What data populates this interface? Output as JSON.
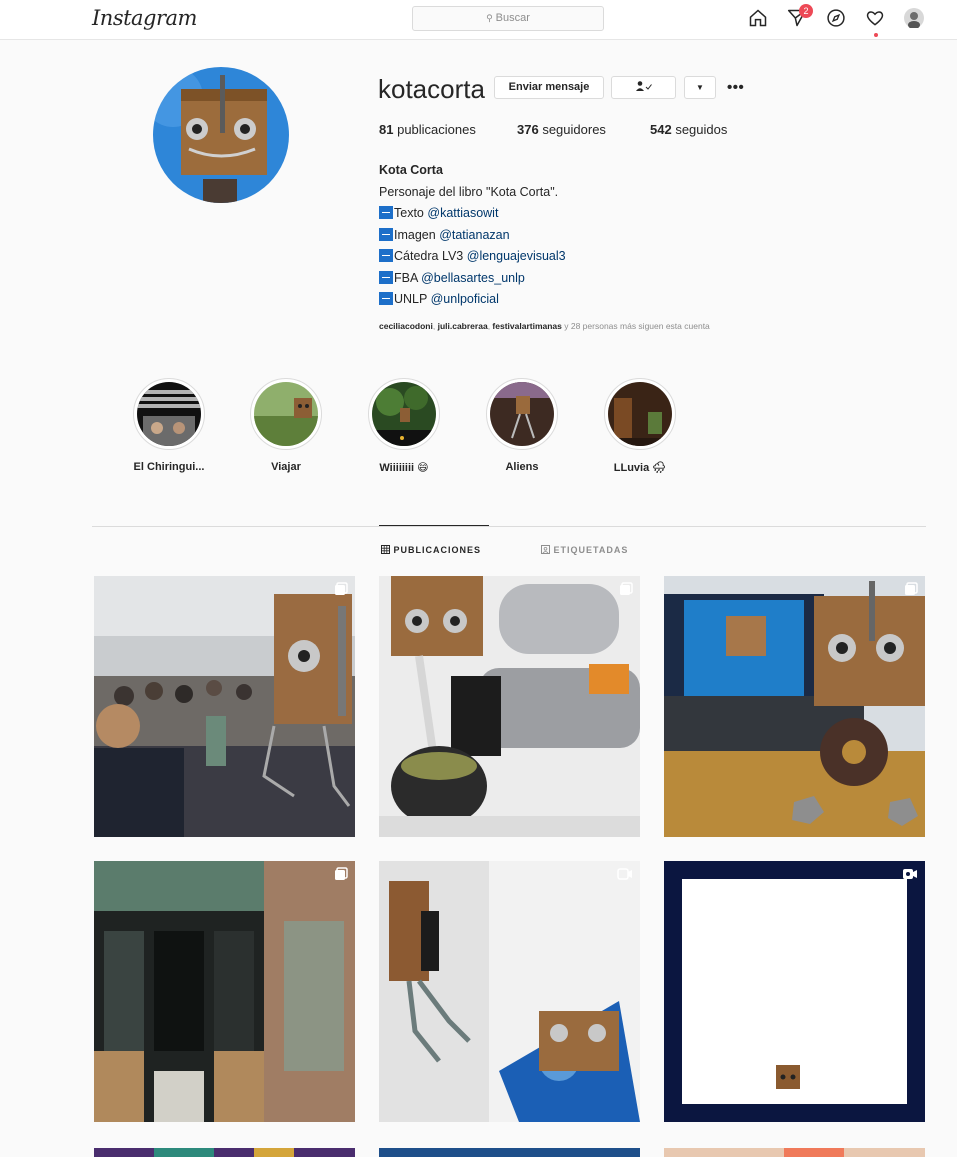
{
  "nav": {
    "logo": "Instagram",
    "search_placeholder": "Buscar",
    "notification_count": "2"
  },
  "profile": {
    "username": "kotacorta",
    "message_button": "Enviar mensaje",
    "follow_state_icon": "person-check-icon",
    "dropdown_icon": "caret-down-icon",
    "more_icon": "•••",
    "stats": {
      "posts": "81",
      "posts_label": "publicaciones",
      "followers": "376",
      "followers_label": "seguidores",
      "following": "542",
      "following_label": "seguidos"
    },
    "bio": {
      "name": "Kota Corta",
      "description": "Personaje del libro \"Kota Corta\".",
      "links": [
        {
          "prefix": "Texto",
          "handle": "@kattiasowit"
        },
        {
          "prefix": "Imagen",
          "handle": "@tatianazan"
        },
        {
          "prefix": "Cátedra LV3",
          "handle": "@lenguajevisual3"
        },
        {
          "prefix": "FBA",
          "handle": "@bellasartes_unlp"
        },
        {
          "prefix": "UNLP",
          "handle": "@unlpoficial"
        }
      ]
    },
    "followed_by": {
      "users": [
        "ceciliacodoni",
        "juli.cabreraa",
        "festivalartimanas"
      ],
      "rest": "y 28 personas más siguen esta cuenta"
    }
  },
  "highlights": [
    {
      "label": "El Chiringui..."
    },
    {
      "label": "Viajar"
    },
    {
      "label": "Wiiiiiiii 😄"
    },
    {
      "label": "Aliens"
    },
    {
      "label": "LLuvia 🌧"
    }
  ],
  "tabs": {
    "posts": "PUBLICACIONES",
    "tagged": "ETIQUETADAS"
  },
  "colors": {
    "accent": "#0095f6",
    "link": "#00376b",
    "badge": "#ed4956"
  }
}
